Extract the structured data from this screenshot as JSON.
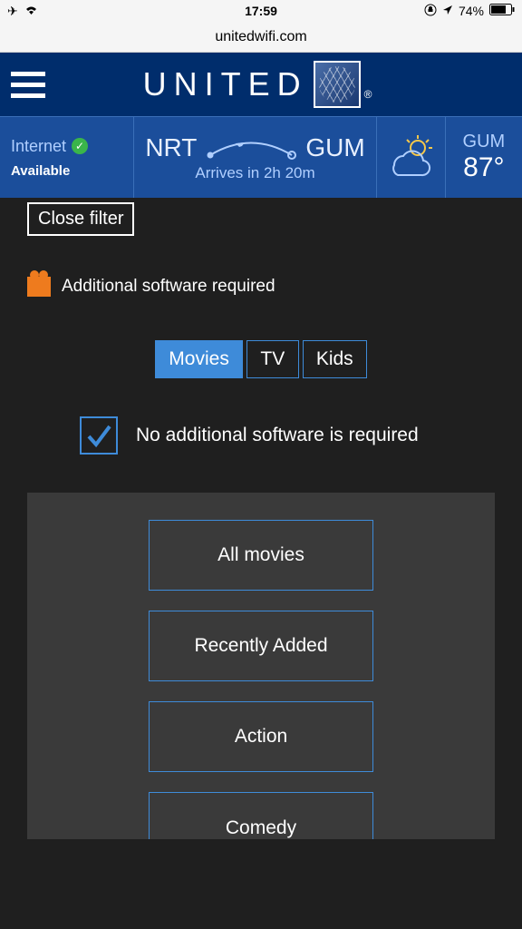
{
  "status": {
    "time": "17:59",
    "battery": "74%"
  },
  "url": "unitedwifi.com",
  "brand": "UNITED",
  "info": {
    "internet_label": "Internet",
    "internet_status": "Available",
    "origin": "NRT",
    "dest": "GUM",
    "arrival": "Arrives in 2h 20m",
    "weather_loc": "GUM",
    "weather_temp": "87°"
  },
  "filter": {
    "close": "Close filter",
    "software_required": "Additional software required",
    "no_software": "No additional software is required"
  },
  "tabs": [
    "Movies",
    "TV",
    "Kids"
  ],
  "genres": [
    "All movies",
    "Recently Added",
    "Action",
    "Comedy"
  ]
}
